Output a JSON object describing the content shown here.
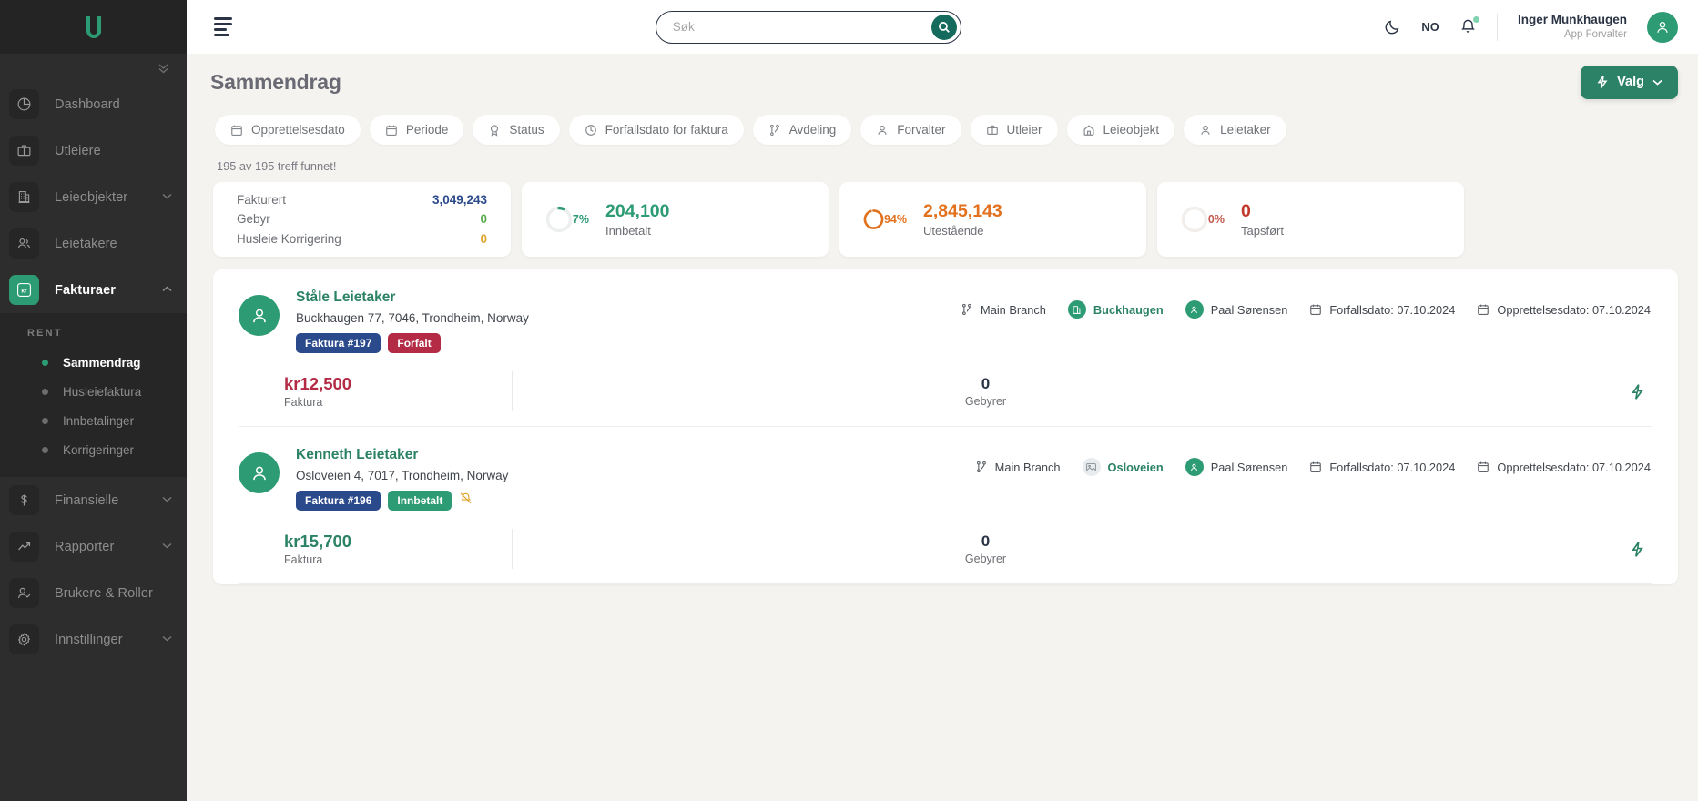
{
  "brand": {
    "logo_letter": "U",
    "accent": "#2d9b73"
  },
  "sidebar": {
    "items": [
      {
        "label": "Dashboard",
        "icon": "pie-chart-icon",
        "caret": false,
        "active": false
      },
      {
        "label": "Utleiere",
        "icon": "briefcase-icon",
        "caret": false,
        "active": false
      },
      {
        "label": "Leieobjekter",
        "icon": "building-icon",
        "caret": true,
        "active": false
      },
      {
        "label": "Leietakere",
        "icon": "users-icon",
        "caret": false,
        "active": false
      },
      {
        "label": "Fakturaer",
        "icon": "kr-icon",
        "caret": true,
        "active": true
      }
    ],
    "section_title": "RENT",
    "sub_items": [
      {
        "label": "Sammendrag",
        "active": true
      },
      {
        "label": "Husleiefaktura",
        "active": false
      },
      {
        "label": "Innbetalinger",
        "active": false
      },
      {
        "label": "Korrigeringer",
        "active": false
      }
    ],
    "items_bottom": [
      {
        "label": "Finansielle",
        "icon": "dollar-icon",
        "caret": true
      },
      {
        "label": "Rapporter",
        "icon": "trending-up-icon",
        "caret": true
      },
      {
        "label": "Brukere & Roller",
        "icon": "user-check-icon",
        "caret": false
      },
      {
        "label": "Innstillinger",
        "icon": "gear-icon",
        "caret": true
      }
    ]
  },
  "topbar": {
    "search_placeholder": "Søk",
    "search_value": "",
    "language": "NO",
    "user_name": "Inger Munkhaugen",
    "user_role": "App Forvalter"
  },
  "page": {
    "title": "Sammendrag",
    "action_button": "Valg",
    "hits": "195 av 195 treff funnet!"
  },
  "filters": [
    {
      "label": "Opprettelsesdato",
      "icon": "calendar-icon"
    },
    {
      "label": "Periode",
      "icon": "calendar-icon"
    },
    {
      "label": "Status",
      "icon": "award-icon"
    },
    {
      "label": "Forfallsdato for faktura",
      "icon": "clock-icon"
    },
    {
      "label": "Avdeling",
      "icon": "branch-icon"
    },
    {
      "label": "Forvalter",
      "icon": "user-icon"
    },
    {
      "label": "Utleier",
      "icon": "briefcase-icon"
    },
    {
      "label": "Leieobjekt",
      "icon": "home-icon"
    },
    {
      "label": "Leietaker",
      "icon": "user-icon"
    }
  ],
  "kpis": {
    "summary_rows": [
      {
        "key": "Fakturert",
        "value": "3,049,243",
        "color": "#2b4a8b"
      },
      {
        "key": "Gebyr",
        "value": "0",
        "color": "#5bab4e"
      },
      {
        "key": "Husleie Korrigering",
        "value": "0",
        "color": "#e0a32a"
      }
    ],
    "donuts": [
      {
        "pct": "7%",
        "pct_num": 7,
        "value": "204,100",
        "label": "Innbetalt",
        "color": "#2d9b73"
      },
      {
        "pct": "94%",
        "pct_num": 94,
        "value": "2,845,143",
        "label": "Utestående",
        "color": "#e2711d"
      },
      {
        "pct": "0%",
        "pct_num": 0,
        "value": "0",
        "label": "Tapsført",
        "color": "#d9534f"
      }
    ]
  },
  "invoices": [
    {
      "name": "Ståle Leietaker",
      "address": "Buckhaugen 77, 7046, Trondheim, Norway",
      "invoice_badge": "Faktura #197",
      "status_badge": "Forfalt",
      "status_type": "overdue",
      "muted_icon": false,
      "branch": "Main Branch",
      "property": "Buckhaugen",
      "property_icon": "building-icon",
      "manager": "Paal Sørensen",
      "due": "Forfallsdato: 07.10.2024",
      "created": "Opprettelsesdato: 07.10.2024",
      "amount": "kr12,500",
      "amount_color": "#b32b45",
      "amount_label": "Faktura",
      "fee": "0",
      "fee_label": "Gebyrer"
    },
    {
      "name": "Kenneth Leietaker",
      "address": "Osloveien 4, 7017, Trondheim, Norway",
      "invoice_badge": "Faktura #196",
      "status_badge": "Innbetalt",
      "status_type": "paid",
      "muted_icon": true,
      "branch": "Main Branch",
      "property": "Osloveien",
      "property_icon": "image-icon",
      "manager": "Paal Sørensen",
      "due": "Forfallsdato: 07.10.2024",
      "created": "Opprettelsesdato: 07.10.2024",
      "amount": "kr15,700",
      "amount_color": "#2c8266",
      "amount_label": "Faktura",
      "fee": "0",
      "fee_label": "Gebyrer"
    }
  ]
}
